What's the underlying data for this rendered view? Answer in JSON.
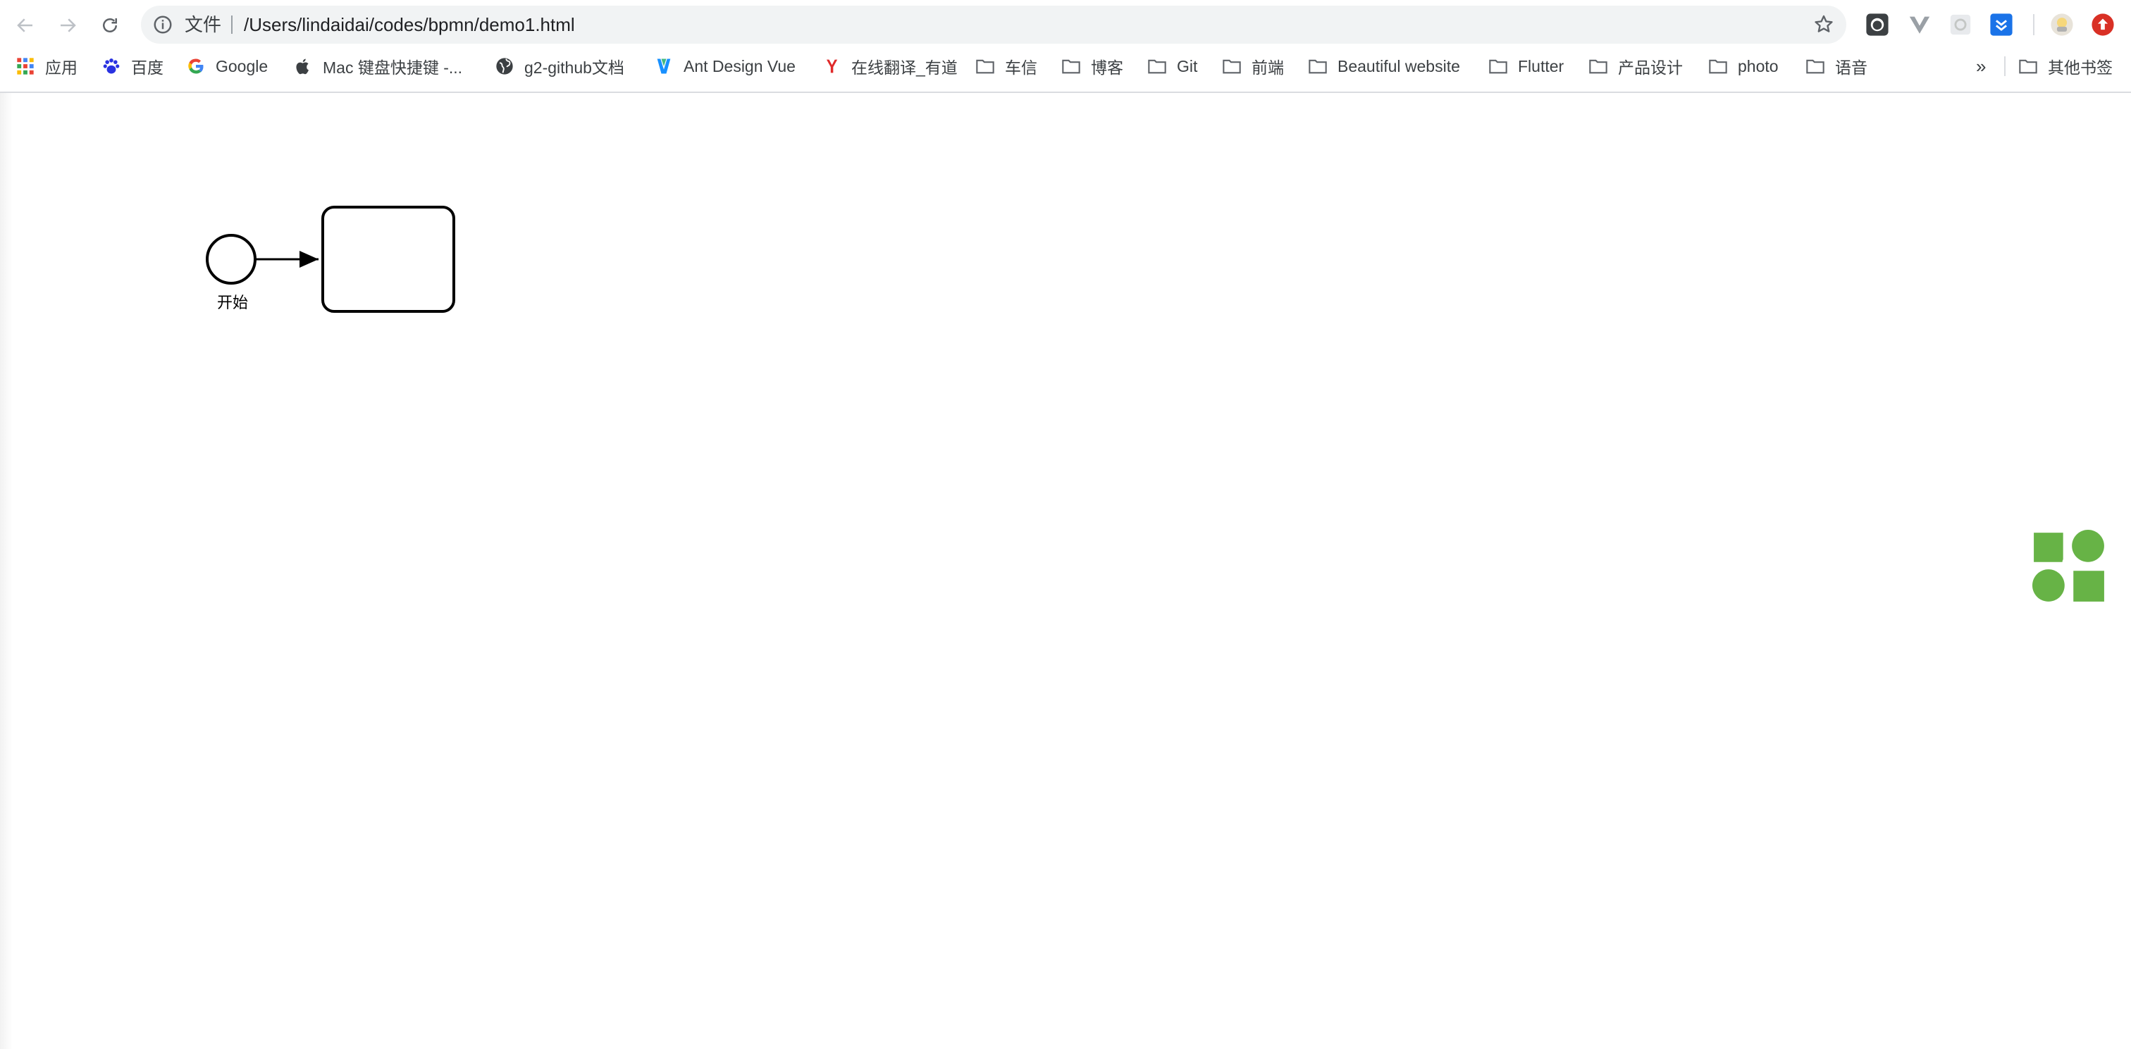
{
  "browser": {
    "scheme_label": "文件",
    "url": "/Users/lindaidai/codes/bpmn/demo1.html",
    "bookmarks": [
      {
        "label": "应用",
        "icon": "apps-grid-icon"
      },
      {
        "label": "百度",
        "icon": "baidu-paw-icon"
      },
      {
        "label": "Google",
        "icon": "google-g-icon"
      },
      {
        "label": "Mac 键盘快捷键 -...",
        "icon": "apple-icon"
      },
      {
        "label": "g2-github文档",
        "icon": "globe-icon"
      },
      {
        "label": "Ant Design Vue",
        "icon": "ant-design-vue-icon"
      },
      {
        "label": "在线翻译_有道",
        "icon": "youdao-icon"
      },
      {
        "label": "车信",
        "icon": "folder-icon"
      },
      {
        "label": "博客",
        "icon": "folder-icon"
      },
      {
        "label": "Git",
        "icon": "folder-icon"
      },
      {
        "label": "前端",
        "icon": "folder-icon"
      },
      {
        "label": "Beautiful website",
        "icon": "folder-icon"
      },
      {
        "label": "Flutter",
        "icon": "folder-icon"
      },
      {
        "label": "产品设计",
        "icon": "folder-icon"
      },
      {
        "label": "photo",
        "icon": "folder-icon"
      },
      {
        "label": "语音",
        "icon": "folder-icon"
      }
    ],
    "overflow_label": "»",
    "other_bookmarks": {
      "label": "其他书签",
      "icon": "folder-icon"
    },
    "extensions": [
      "github-icon",
      "vue-devtools-icon",
      "extension-grey-icon",
      "blue-download-icon",
      "avatar-icon",
      "red-upload-icon"
    ]
  },
  "diagram": {
    "start_event_label": "开始",
    "colors": {
      "stroke": "#000000",
      "logo": "#67b346"
    }
  }
}
